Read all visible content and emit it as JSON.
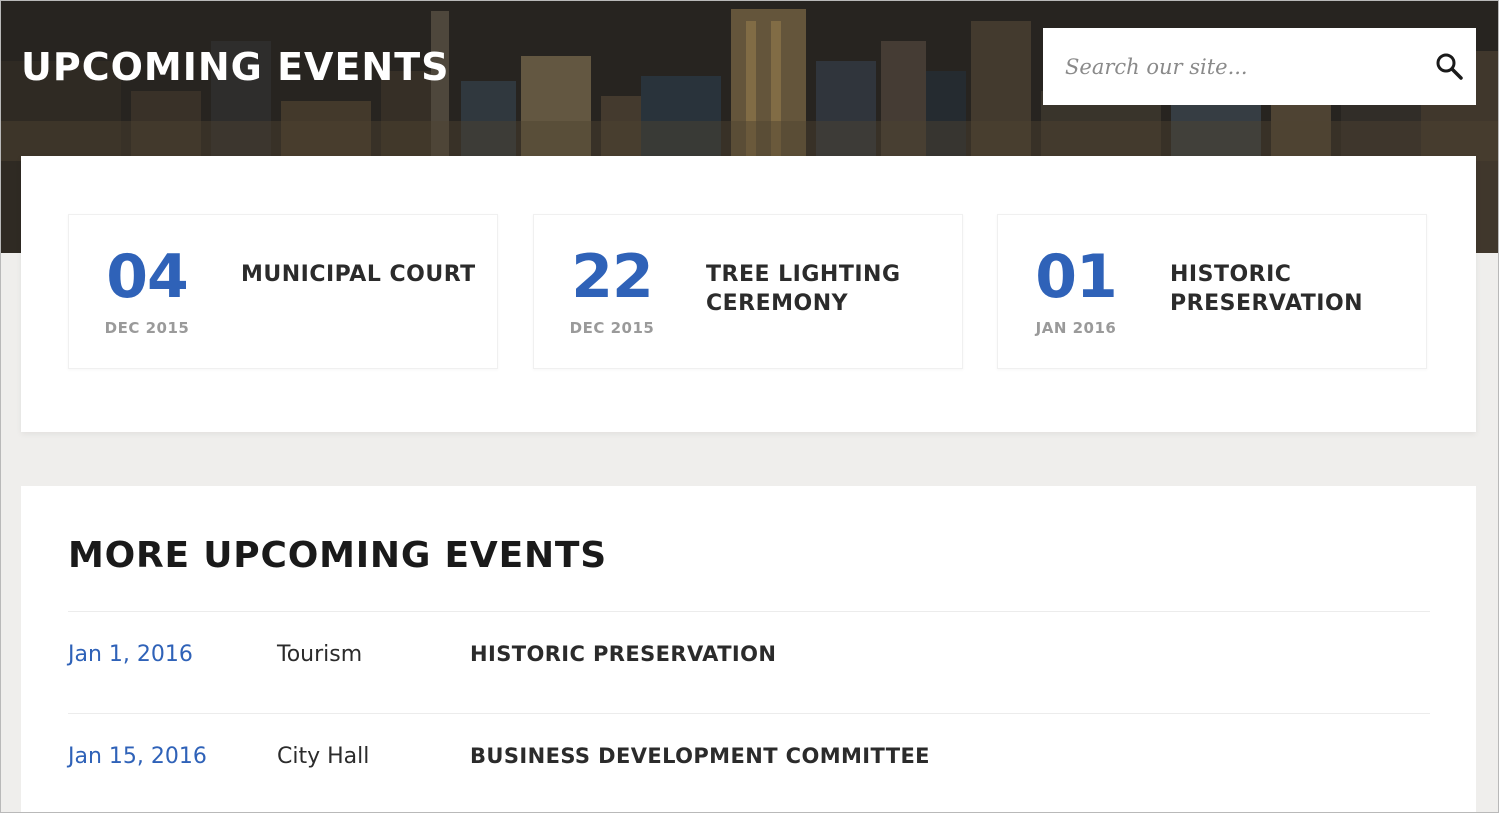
{
  "hero": {
    "title": "UPCOMING EVENTS"
  },
  "search": {
    "placeholder": "Search our site...",
    "icon": "search-icon"
  },
  "featured_events": [
    {
      "day": "04",
      "month": "DEC 2015",
      "name": "MUNICIPAL COURT"
    },
    {
      "day": "22",
      "month": "DEC 2015",
      "name": "TREE LIGHTING CEREMONY"
    },
    {
      "day": "01",
      "month": "JAN 2016",
      "name": "HISTORIC PRESERVATION"
    }
  ],
  "more_events": {
    "title": "MORE UPCOMING EVENTS",
    "rows": [
      {
        "date": "Jan 1, 2016",
        "category": "Tourism",
        "title": "HISTORIC PRESERVATION"
      },
      {
        "date": "Jan 15, 2016",
        "category": "City Hall",
        "title": "BUSINESS DEVELOPMENT COMMITTEE"
      }
    ]
  },
  "colors": {
    "accent": "#2f62b8",
    "heading": "#1a1a1a",
    "muted": "#9a9a9a",
    "background": "#efeeec"
  }
}
